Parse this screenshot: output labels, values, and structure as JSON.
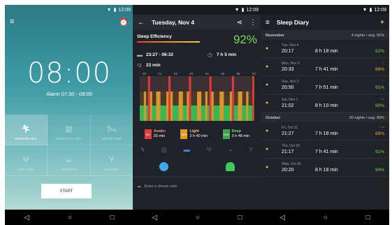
{
  "status": {
    "time": "12:09"
  },
  "nav": {
    "back": "◁",
    "home": "○",
    "recent": "□"
  },
  "screen1": {
    "clock": "08:00",
    "alarm": "Alarm 07:30 - 08:00",
    "tags": [
      {
        "label": "WORKED OUT",
        "icon": "running-icon",
        "active": true
      },
      {
        "label": "STRESSFUL DAY",
        "icon": "chart-icon",
        "active": false
      },
      {
        "label": "NOT MY BED",
        "icon": "bed-icon",
        "active": false
      },
      {
        "label": "ATE LATE",
        "icon": "fork-knife-icon",
        "active": false
      },
      {
        "label": "CAFFEINE",
        "icon": "coffee-cup-icon",
        "active": false
      },
      {
        "label": "ALCOHOL",
        "icon": "wine-glass-icon",
        "active": false
      }
    ],
    "start": "START"
  },
  "screen2": {
    "title": "Tuesday, Nov 4",
    "efficiency_label": "Sleep Efficiency",
    "efficiency_value": "92%",
    "bed_time": "23:27 - 06:32",
    "duration": "7 h 5 min",
    "latency": "23 min",
    "ticks": [
      "00",
      "01",
      "02",
      "03",
      "04",
      "05",
      "06",
      "07"
    ],
    "legend": [
      {
        "pct": "8%",
        "label": "Awake",
        "value": "30 min",
        "color": "#e23b3b"
      },
      {
        "pct": "38%",
        "label": "Light",
        "value": "2 h 40 min",
        "color": "#f2a62e"
      },
      {
        "pct": "54%",
        "label": "Deep",
        "value": "3 h 48 min",
        "color": "#3ec75a"
      }
    ],
    "note_placeholder": "Enter a dream note"
  },
  "screen3": {
    "title": "Sleep Diary",
    "months": [
      {
        "name": "November",
        "summary": "4 nights • avg. 91%",
        "entries": [
          {
            "date": "Tue, Nov 4",
            "time": "20:17",
            "duration": "8 h 18 min",
            "pct": "92%",
            "color": "#7ed957",
            "mark": ""
          },
          {
            "date": "Mon, Nov 3",
            "time": "20:33",
            "duration": "7 h 41 min",
            "pct": "88%",
            "color": "#f2a62e",
            "mark": "♀"
          },
          {
            "date": "Sun, Nov 2",
            "time": "20:50",
            "duration": "7 h 51 min",
            "pct": "91%",
            "color": "#7ed957",
            "mark": "…"
          },
          {
            "date": "Sat, Nov 1",
            "time": "21:02",
            "duration": "8 h 10 min",
            "pct": "90%",
            "color": "#7ed957",
            "mark": "♂ ▭"
          }
        ]
      },
      {
        "name": "October",
        "summary": "20 nights • avg. 89%",
        "entries": [
          {
            "date": "Fri, Oct 31",
            "time": "21:27",
            "duration": "7 h 18 min",
            "pct": "89%",
            "color": "#f2a62e",
            "mark": "♀ ▭"
          },
          {
            "date": "Thu, Oct 30",
            "time": "21:17",
            "duration": "7 h 41 min",
            "pct": "91%",
            "color": "#7ed957",
            "mark": "…"
          },
          {
            "date": "Wed, Oct 29",
            "time": "20:20",
            "duration": "8 h 18 min",
            "pct": "94%",
            "color": "#7ed957",
            "mark": "…"
          }
        ]
      }
    ]
  }
}
